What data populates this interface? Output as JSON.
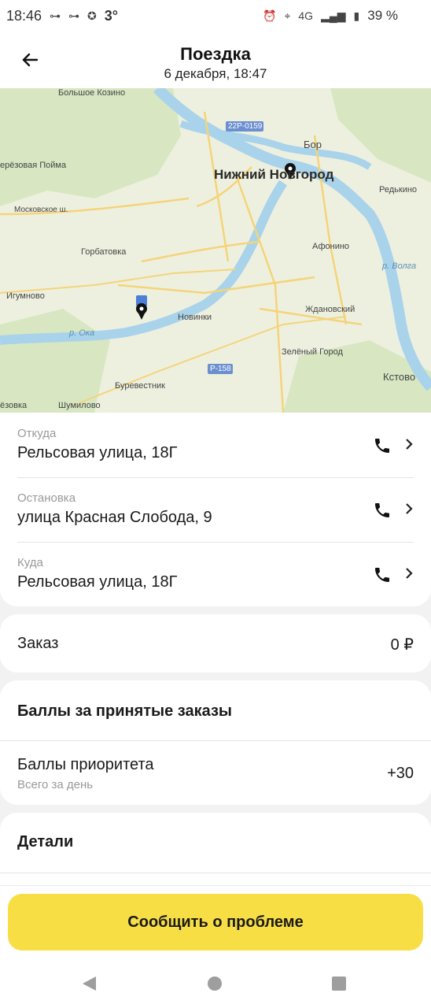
{
  "status": {
    "time": "18:46",
    "temp": "3°",
    "network": "4G",
    "battery": "39 %"
  },
  "header": {
    "title": "Поездка",
    "subtitle": "6 декабря, 18:47"
  },
  "map": {
    "city": "Нижний Новгород",
    "labels": [
      "Большое Козино",
      "22Р-0159",
      "Бор",
      "ерёзовая Пойма",
      "Редькино",
      "Московское ш.",
      "Горбатовка",
      "Афонино",
      "Игумново",
      "р. Волга",
      "Новинки",
      "Ждановский",
      "р. Ока",
      "Зелёный Город",
      "Р-158",
      "Буревестник",
      "Кстово",
      "ёзовка",
      "Шумилово"
    ]
  },
  "route": [
    {
      "label": "Откуда",
      "value": "Рельсовая улица, 18Г"
    },
    {
      "label": "Остановка",
      "value": "улица Красная Слобода, 9"
    },
    {
      "label": "Куда",
      "value": "Рельсовая улица, 18Г"
    }
  ],
  "order": {
    "label": "Заказ",
    "value": "0 ₽"
  },
  "points": {
    "title": "Баллы за принятые заказы",
    "priority_label": "Баллы приоритета",
    "priority_hint": "Всего за день",
    "priority_value": "+30"
  },
  "details": {
    "label": "Детали"
  },
  "cta": {
    "label": "Сообщить о проблеме"
  },
  "colors": {
    "accent": "#f7de45",
    "water": "#a9d3ea",
    "road": "#f4d47a"
  }
}
